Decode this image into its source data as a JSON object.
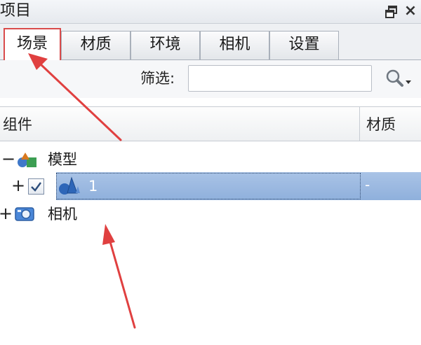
{
  "panel": {
    "title": "项目"
  },
  "tabs": [
    {
      "label": "场景",
      "active": true
    },
    {
      "label": "材质",
      "active": false
    },
    {
      "label": "环境",
      "active": false
    },
    {
      "label": "相机",
      "active": false
    },
    {
      "label": "设置",
      "active": false
    }
  ],
  "filter": {
    "label": "筛选:",
    "value": "",
    "placeholder": ""
  },
  "tree": {
    "columns": {
      "component": "组件",
      "material": "材质"
    },
    "nodes": [
      {
        "expander": "−",
        "icon": "model-group-icon",
        "label": "模型"
      },
      {
        "expander": "+",
        "icon": "cone-shape-icon",
        "label": "1",
        "checked": true,
        "selected": true,
        "material": "-"
      },
      {
        "expander": "+",
        "icon": "camera-icon",
        "label": "相机"
      }
    ]
  },
  "colors": {
    "selection": "#9cb9e1",
    "annotation": "#e04040",
    "active_tab_border": "#d94b4b"
  }
}
